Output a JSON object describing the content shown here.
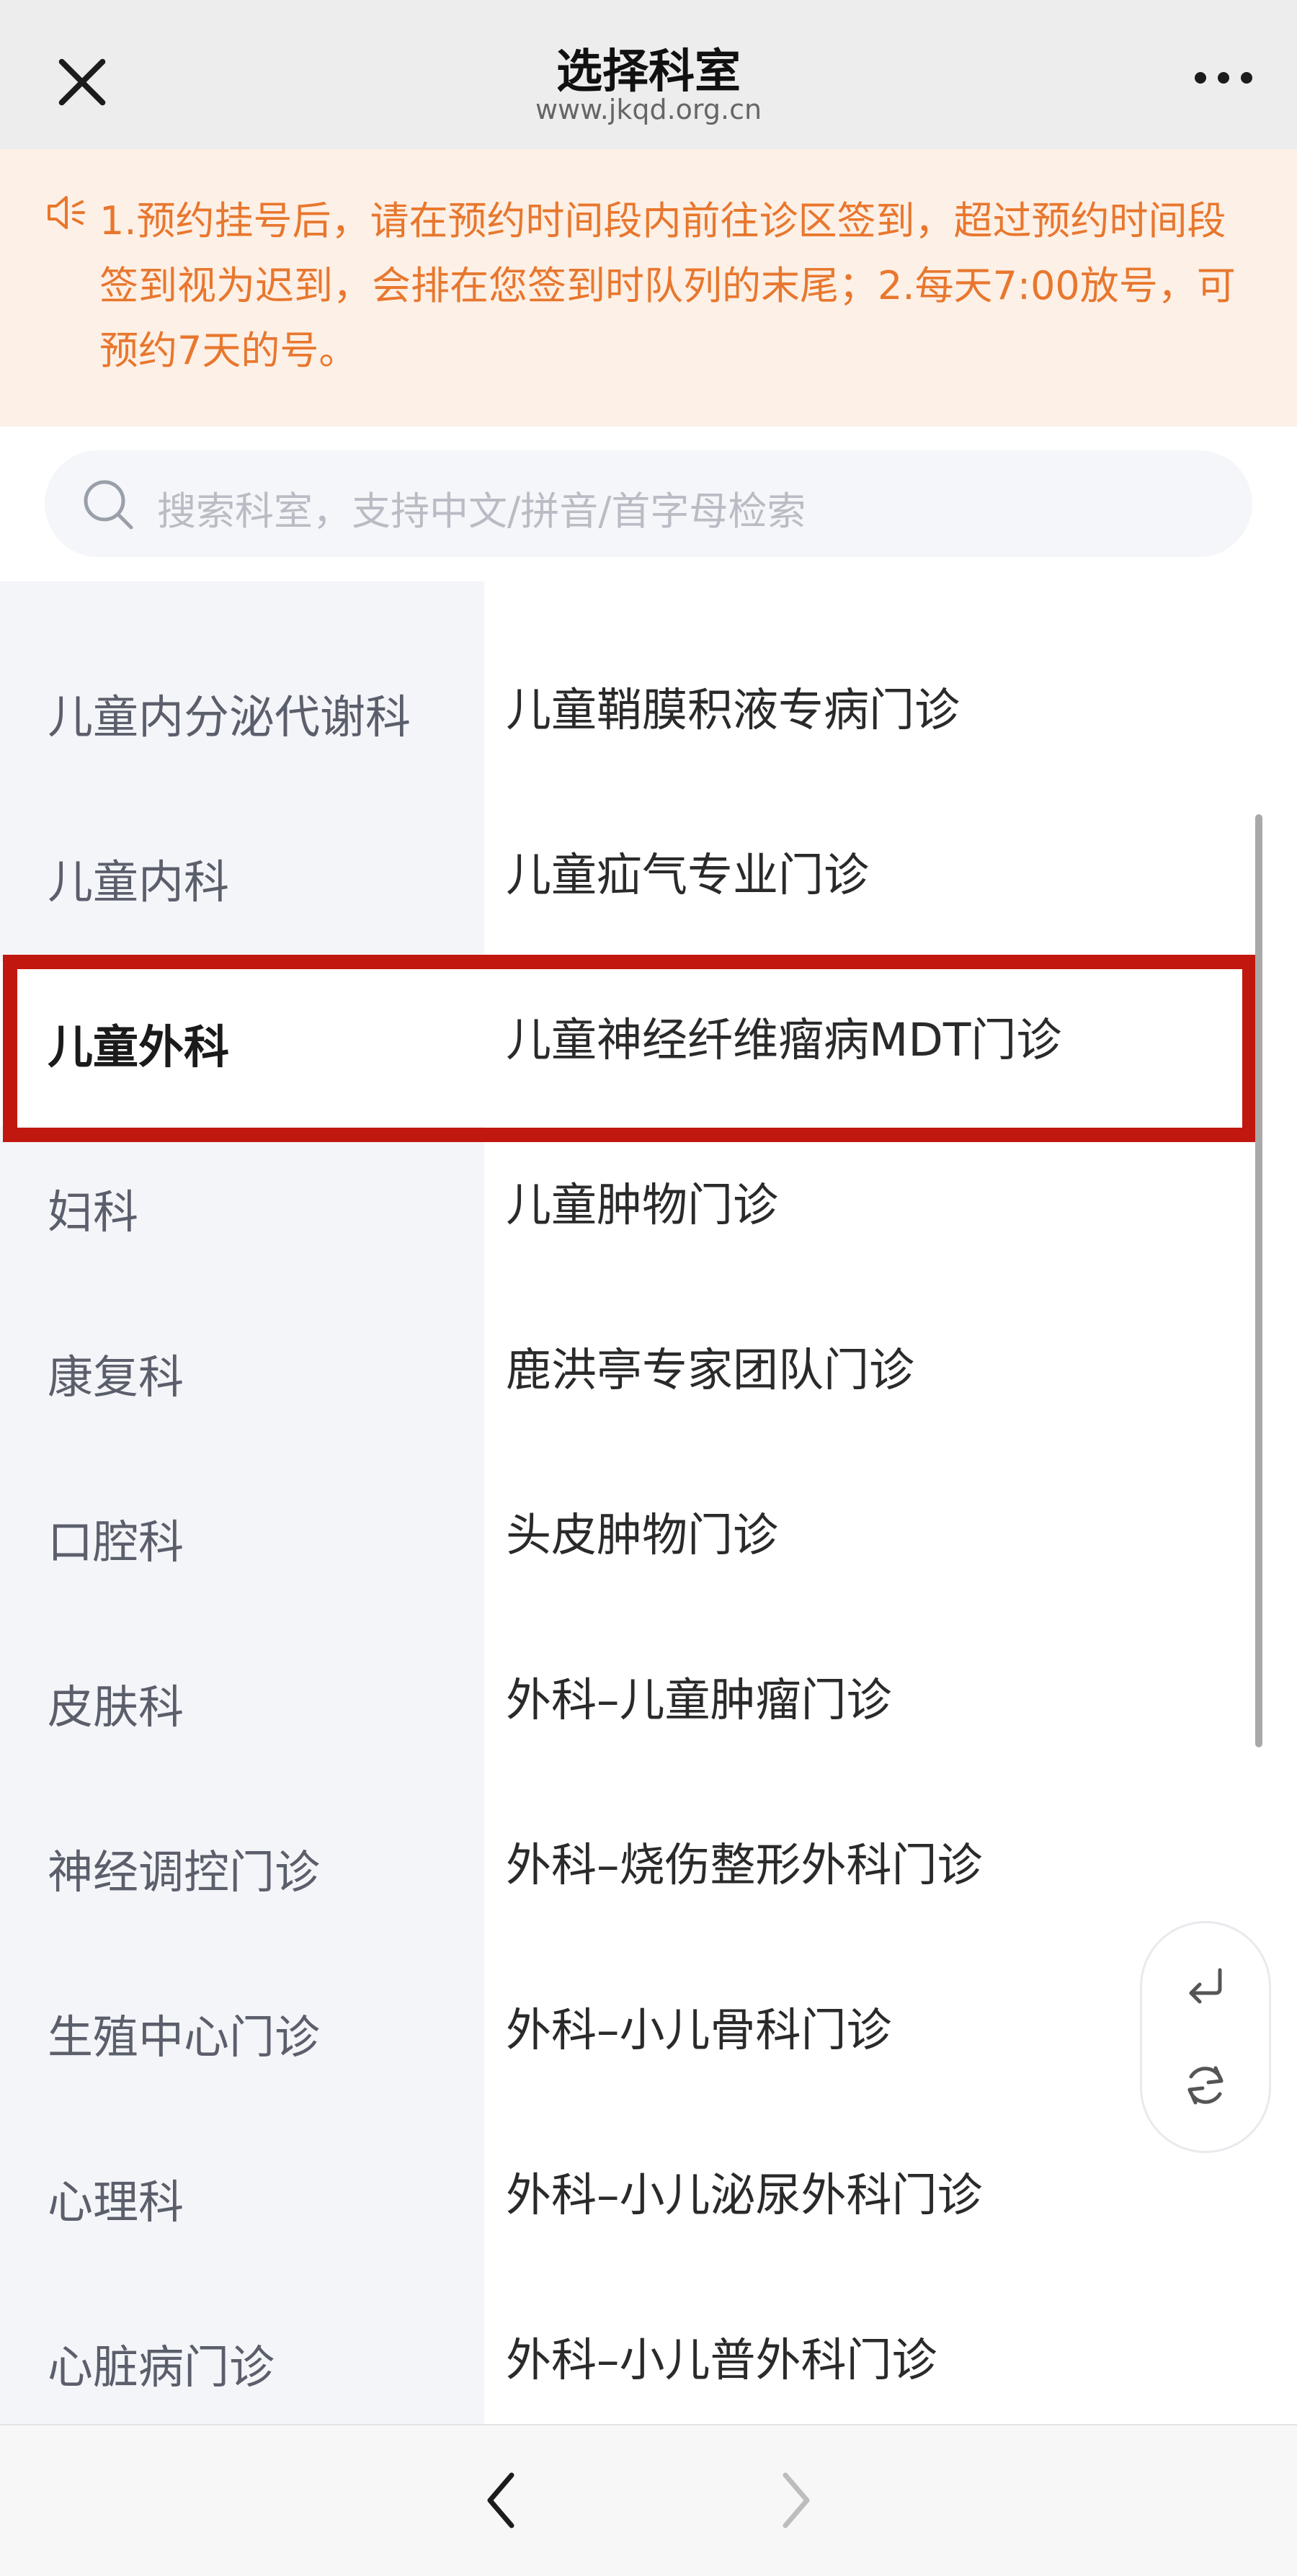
{
  "header": {
    "title": "选择科室",
    "url": "www.jkqd.org.cn"
  },
  "notice": {
    "text": "1.预约挂号后，请在预约时间段内前往诊区签到，超过预约时间段签到视为迟到，会排在您签到时队列的末尾；2.每天7:00放号，可预约7天的号。"
  },
  "search": {
    "placeholder": "搜索科室，支持中文/拼音/首字母检索"
  },
  "departments": [
    "儿童内分泌代谢科",
    "儿童内科",
    "儿童外科",
    "妇科",
    "康复科",
    "口腔科",
    "皮肤科",
    "神经调控门诊",
    "生殖中心门诊",
    "心理科",
    "心脏病门诊"
  ],
  "active_department": "儿童外科",
  "clinics": [
    "儿童鞘膜积液专病门诊",
    "儿童疝气专业门诊",
    "儿童神经纤维瘤病MDT门诊",
    "儿童肿物门诊",
    "鹿洪亭专家团队门诊",
    "头皮肿物门诊",
    "外科–儿童肿瘤门诊",
    "外科–烧伤整形外科门诊",
    "外科–小儿骨科门诊",
    "外科–小儿泌尿外科门诊",
    "外科–小儿普外科门诊"
  ],
  "colors": {
    "notice_text": "#e8772e",
    "notice_bg": "#fdf0e6",
    "highlight": "#c0170f",
    "left_bg": "#f4f5f9"
  }
}
